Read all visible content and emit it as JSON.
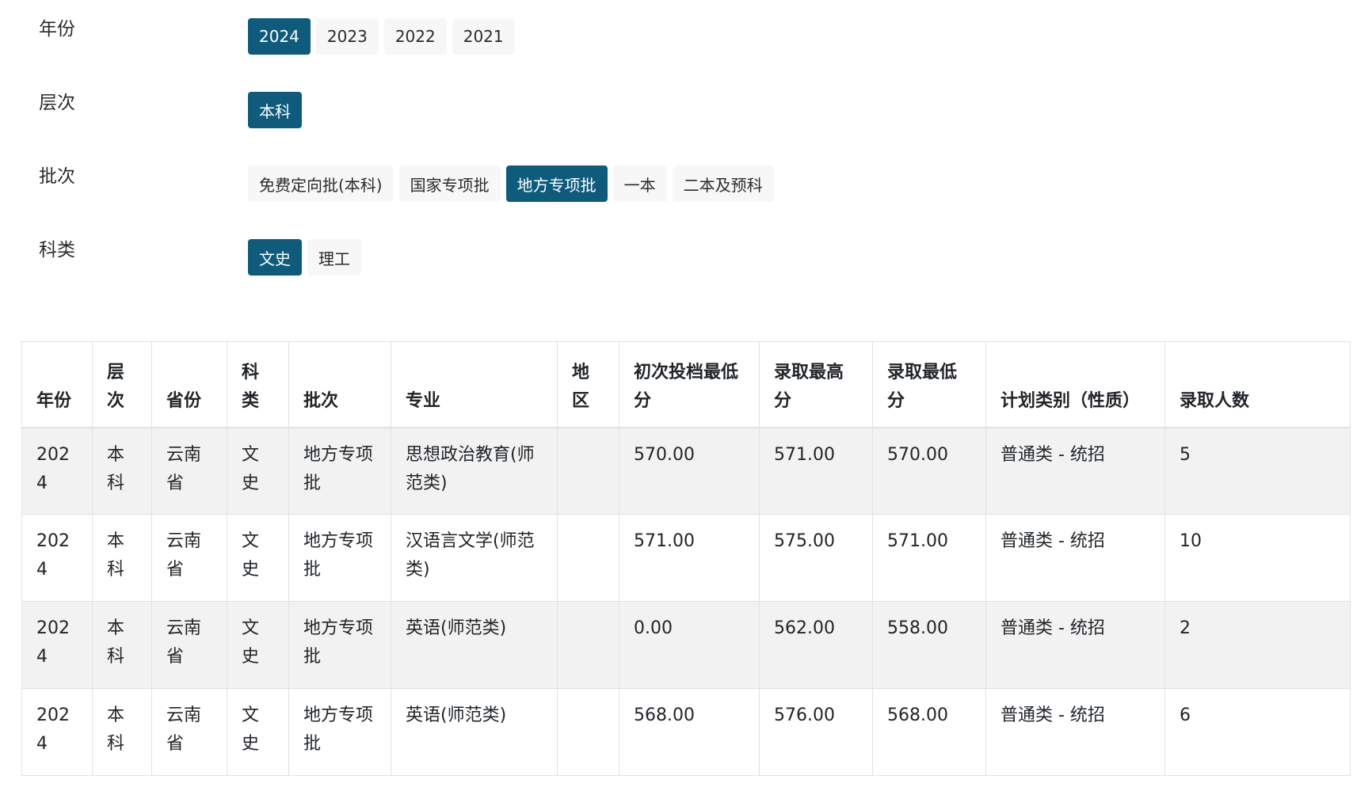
{
  "filters": {
    "year": {
      "label": "年份",
      "options": [
        "2024",
        "2023",
        "2022",
        "2021"
      ],
      "selected": "2024"
    },
    "level": {
      "label": "层次",
      "options": [
        "本科"
      ],
      "selected": "本科"
    },
    "batch": {
      "label": "批次",
      "options": [
        "免费定向批(本科)",
        "国家专项批",
        "地方专项批",
        "一本",
        "二本及预科"
      ],
      "selected": "地方专项批"
    },
    "category": {
      "label": "科类",
      "options": [
        "文史",
        "理工"
      ],
      "selected": "文史"
    }
  },
  "table": {
    "headers": [
      "年份",
      "层次",
      "省份",
      "科类",
      "批次",
      "专业",
      "地区",
      "初次投档最低分",
      "录取最高分",
      "录取最低分",
      "计划类别（性质）",
      "录取人数"
    ],
    "rows": [
      [
        "2024",
        "本科",
        "云南省",
        "文史",
        "地方专项批",
        "思想政治教育(师范类)",
        "",
        "570.00",
        "571.00",
        "570.00",
        "普通类 - 统招",
        "5"
      ],
      [
        "2024",
        "本科",
        "云南省",
        "文史",
        "地方专项批",
        "汉语言文学(师范类)",
        "",
        "571.00",
        "575.00",
        "571.00",
        "普通类 - 统招",
        "10"
      ],
      [
        "2024",
        "本科",
        "云南省",
        "文史",
        "地方专项批",
        "英语(师范类)",
        "",
        "0.00",
        "562.00",
        "558.00",
        "普通类 - 统招",
        "2"
      ],
      [
        "2024",
        "本科",
        "云南省",
        "文史",
        "地方专项批",
        "英语(师范类)",
        "",
        "568.00",
        "576.00",
        "568.00",
        "普通类 - 统招",
        "6"
      ]
    ]
  },
  "colors": {
    "active_chip": "#0e5b7c",
    "chip_bg": "#f7f7f7",
    "stripe_bg": "#f2f2f2",
    "border": "#dee2e6"
  }
}
